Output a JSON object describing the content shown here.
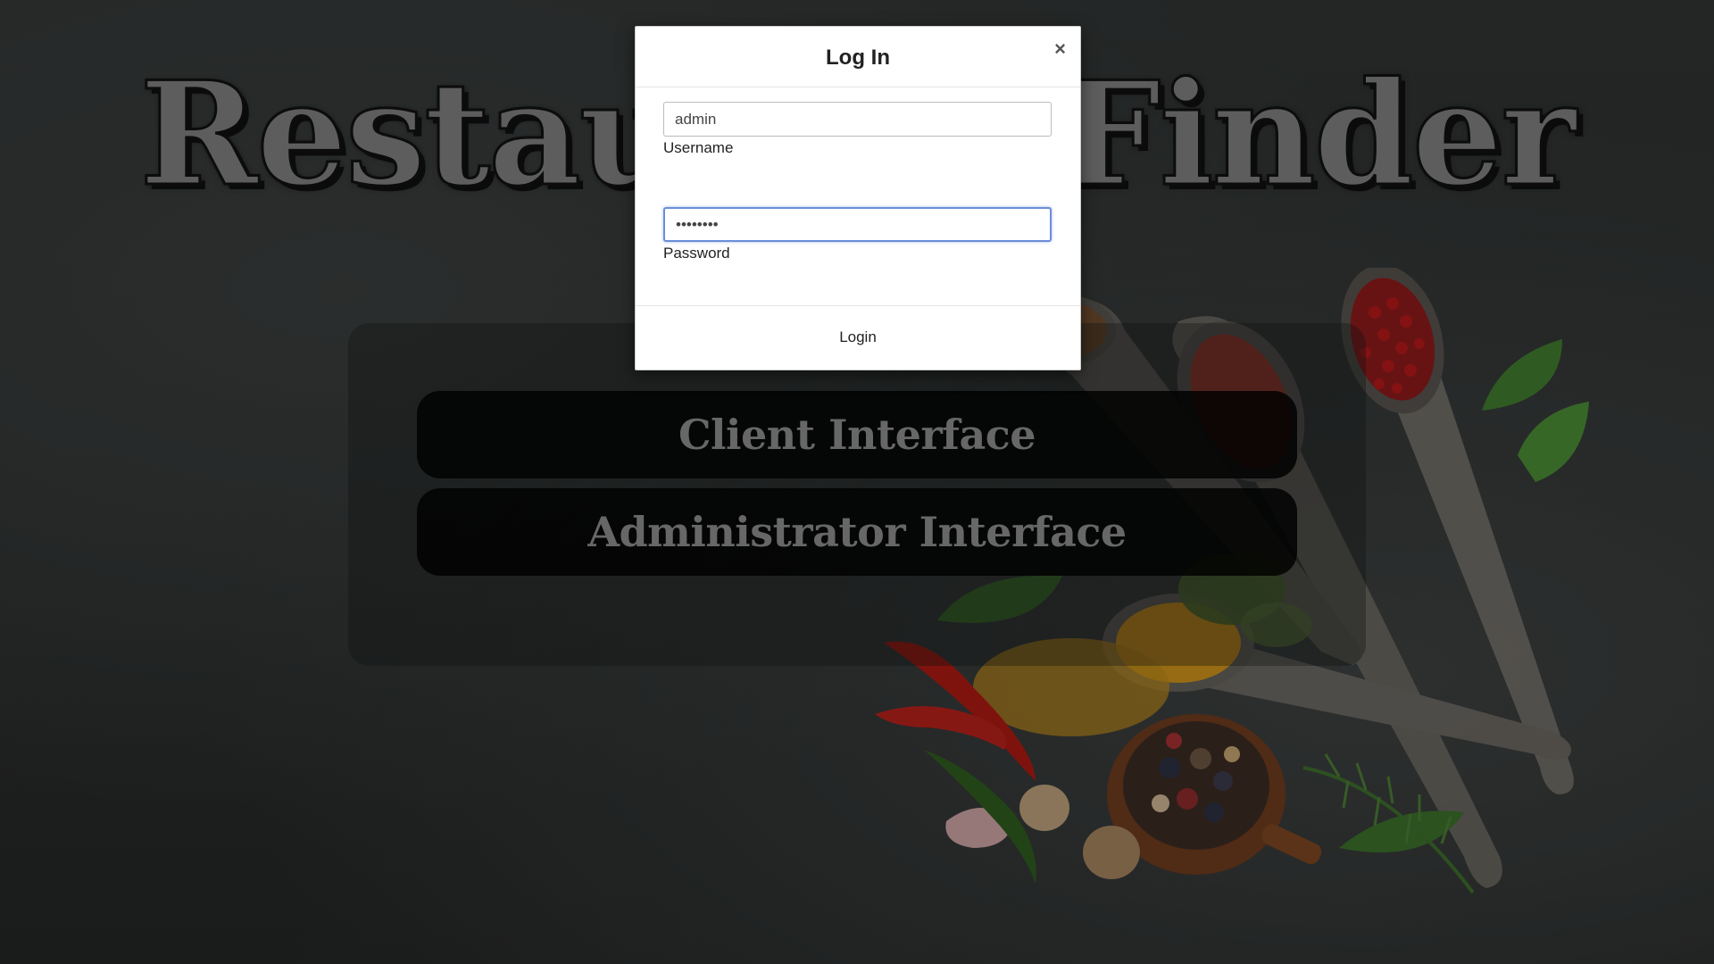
{
  "hero": {
    "title": "Restaurant Finder"
  },
  "interfaces": {
    "client_label": "Client Interface",
    "admin_label": "Administrator Interface"
  },
  "modal": {
    "title": "Log In",
    "close_glyph": "×",
    "username": {
      "value": "admin",
      "label": "Username"
    },
    "password": {
      "value": "password",
      "label": "Password"
    },
    "submit_label": "Login"
  },
  "colors": {
    "background": "#2a2c2c",
    "focus_border": "#6a8fd8",
    "title_fill": "#7d7d7d"
  }
}
